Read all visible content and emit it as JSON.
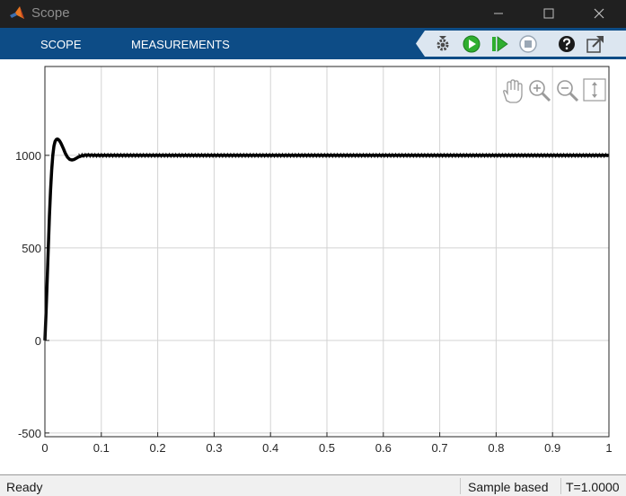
{
  "window": {
    "title": "Scope"
  },
  "toolstrip": {
    "tabs": [
      "SCOPE",
      "MEASUREMENTS"
    ],
    "background_color": "#0d4c86",
    "buttons": [
      {
        "name": "settings-gear-icon"
      },
      {
        "name": "run-icon",
        "color": "#2fae2f"
      },
      {
        "name": "step-forward-icon",
        "color": "#2fae2f"
      },
      {
        "name": "stop-icon",
        "color": "#9aa7b5"
      },
      {
        "name": "help-icon"
      },
      {
        "name": "undock-icon"
      }
    ]
  },
  "plot_tools": [
    "pan-hand-icon",
    "zoom-in-icon",
    "zoom-out-icon",
    "zoom-y-icon"
  ],
  "chart_data": {
    "type": "line",
    "title": "",
    "xlabel": "",
    "ylabel": "",
    "xlim": [
      0,
      1
    ],
    "ylim": [
      -520,
      1480
    ],
    "x_ticks": [
      0,
      0.1,
      0.2,
      0.3,
      0.4,
      0.5,
      0.6,
      0.7,
      0.8,
      0.9,
      1
    ],
    "x_tick_labels": [
      "0",
      "0.1",
      "0.2",
      "0.3",
      "0.4",
      "0.5",
      "0.6",
      "0.7",
      "0.8",
      "0.9",
      "1"
    ],
    "y_ticks": [
      -500,
      0,
      500,
      1000
    ],
    "y_tick_labels": [
      "-500",
      "0",
      "500",
      "1000"
    ],
    "grid": true,
    "series": [
      {
        "color": "#000000",
        "x": [
          0,
          0.002,
          0.004,
          0.006,
          0.008,
          0.01,
          0.012,
          0.014,
          0.016,
          0.018,
          0.02,
          0.022,
          0.024,
          0.026,
          0.028,
          0.03,
          0.033,
          0.036,
          0.04,
          0.044,
          0.048,
          0.052,
          0.056,
          0.06,
          0.065,
          0.07,
          0.075,
          0.08,
          0.09,
          0.1,
          1.0
        ],
        "y": [
          0,
          150,
          320,
          500,
          670,
          810,
          920,
          1000,
          1050,
          1075,
          1085,
          1088,
          1085,
          1078,
          1068,
          1055,
          1035,
          1012,
          990,
          978,
          975,
          978,
          985,
          992,
          997,
          1000,
          1002,
          1001,
          1000,
          1000,
          1000
        ],
        "ripple_amplitude": 10,
        "ripple_start": 0.06
      }
    ]
  },
  "status": {
    "ready": "Ready",
    "mode": "Sample based",
    "time": "T=1.0000"
  }
}
